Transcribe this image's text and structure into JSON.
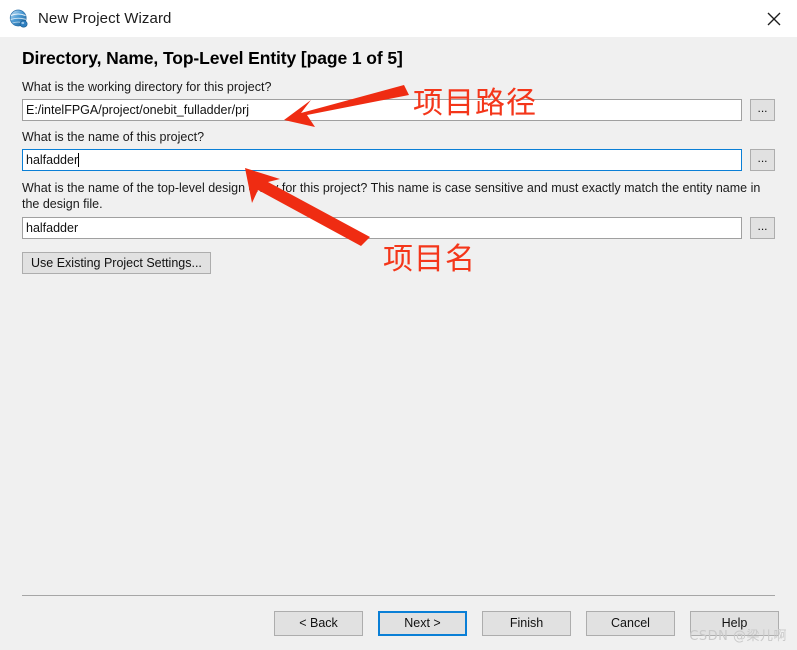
{
  "window": {
    "title": "New Project Wizard",
    "icon": "quartus-globe-icon",
    "close_label": "✕"
  },
  "page": {
    "heading": "Directory, Name, Top-Level Entity [page 1 of 5]"
  },
  "fields": [
    {
      "label": "What is the working directory for this project?",
      "value": "E:/intelFPGA/project/onebit_fulladder/prj",
      "browse_label": "...",
      "focused": false
    },
    {
      "label": "What is the name of this project?",
      "value": "halfadder",
      "browse_label": "...",
      "focused": true
    },
    {
      "label": "What is the name of the top-level design entity for this project? This name is case sensitive and must exactly match the entity name in the design file.",
      "value": "halfadder",
      "browse_label": "...",
      "focused": false
    }
  ],
  "existing_settings": {
    "label": "Use Existing Project Settings..."
  },
  "footer": {
    "buttons": [
      {
        "label": "< Back",
        "default": false
      },
      {
        "label": "Next >",
        "default": true
      },
      {
        "label": "Finish",
        "default": false
      },
      {
        "label": "Cancel",
        "default": false
      },
      {
        "label": "Help",
        "default": false
      }
    ]
  },
  "annotations": [
    {
      "text": "项目路径",
      "name": "annotation-project-path"
    },
    {
      "text": "项目名",
      "name": "annotation-project-name"
    }
  ],
  "watermark": {
    "text": "CSDN @梁儿啊"
  },
  "colors": {
    "accent": "#0a7fd6",
    "annotation": "#f4361a",
    "window_bg": "#f0f0f0",
    "button_bg": "#e1e1e1"
  }
}
